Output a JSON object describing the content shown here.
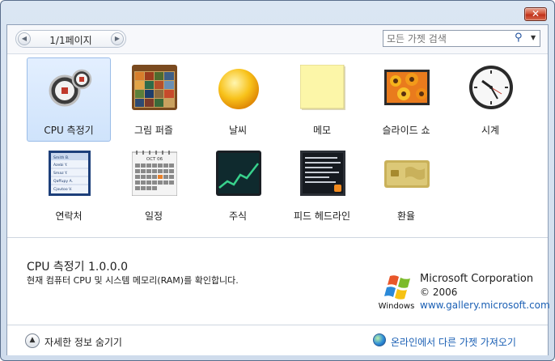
{
  "window": {
    "close_glyph": "✕"
  },
  "toolbar": {
    "page_label": "1/1페이지",
    "search_placeholder": "모든 가젯 검색"
  },
  "gadgets": [
    {
      "label": "CPU 측정기",
      "icon": "cpu-meter-icon",
      "selected": true
    },
    {
      "label": "그림 퍼즐",
      "icon": "picture-puzzle-icon"
    },
    {
      "label": "날씨",
      "icon": "weather-sun-icon"
    },
    {
      "label": "메모",
      "icon": "notes-icon"
    },
    {
      "label": "슬라이드 쇼",
      "icon": "slide-show-icon"
    },
    {
      "label": "시계",
      "icon": "clock-icon"
    },
    {
      "label": "연락처",
      "icon": "contacts-icon",
      "entries": [
        "Smith B.",
        "Azebi Y.",
        "Smaz Y.",
        "Qaffupy A.",
        "Cjoutoo V."
      ]
    },
    {
      "label": "일정",
      "icon": "calendar-icon",
      "month": "OCT 06"
    },
    {
      "label": "주식",
      "icon": "stocks-icon"
    },
    {
      "label": "피드 헤드라인",
      "icon": "feed-headlines-icon"
    },
    {
      "label": "환율",
      "icon": "currency-icon"
    }
  ],
  "details": {
    "title": "CPU 측정기 1.0.0.0",
    "description": "현재 컴퓨터 CPU 및 시스템 메모리(RAM)를 확인합니다.",
    "publisher": "Microsoft Corporation",
    "copyright": "© 2006",
    "url": "www.gallery.microsoft.com",
    "logo_text": "Windows"
  },
  "footer": {
    "hide_details_label": "자세한 정보 숨기기",
    "online_label": "온라인에서 다른 가젯 가져오기"
  }
}
